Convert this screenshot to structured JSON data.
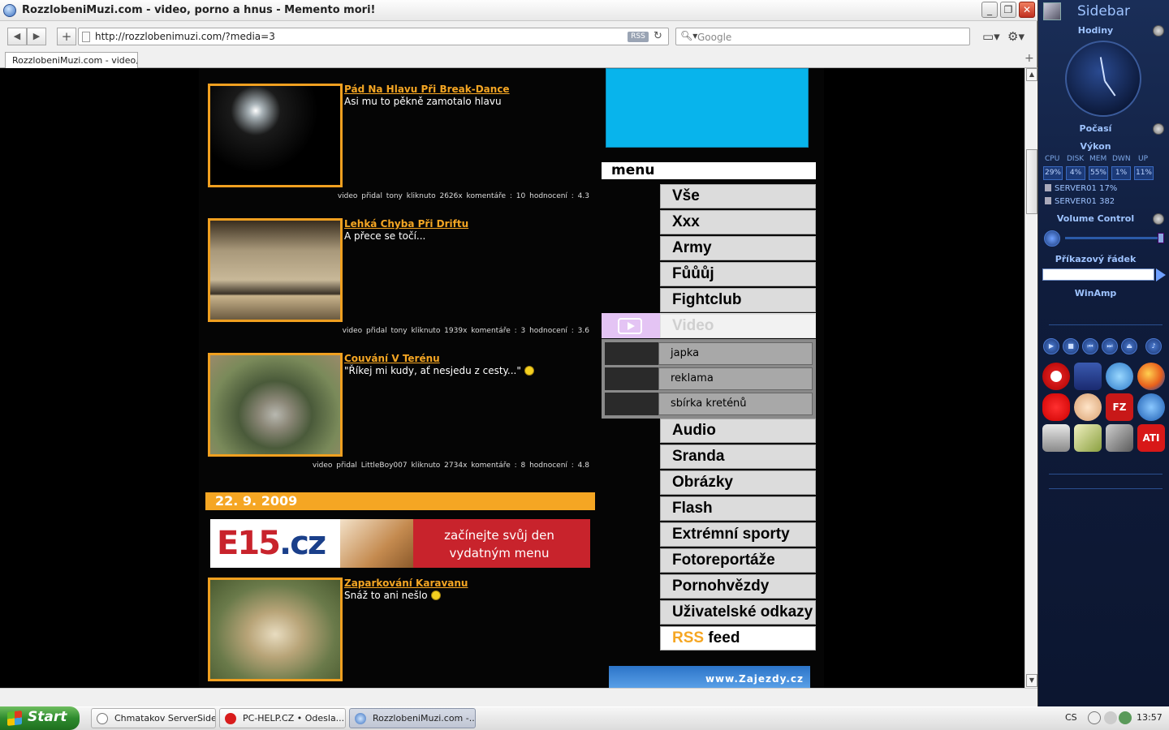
{
  "window": {
    "title": "RozzlobeniMuzi.com - video, porno a hnus - Memento mori!"
  },
  "address": {
    "url": "http://rozzlobenimuzi.com/?media=3",
    "rss": "RSS",
    "search_placeholder": "Google"
  },
  "tab": {
    "label": "RozzlobeniMuzi.com - video,..."
  },
  "items": [
    {
      "title": "Pád Na Hlavu Při Break-Dance",
      "desc": "Asi mu to pěkně zamotalo hlavu",
      "meta": "video  přidal tony  kliknuto 2626x  komentáře : 10   hodnocení : 4.3"
    },
    {
      "title": "Lehká Chyba Při Driftu",
      "desc": "A přece se točí...",
      "meta": "video  přidal tony  kliknuto 1939x  komentáře : 3   hodnocení : 3.6"
    },
    {
      "title": "Couvání V Terénu",
      "desc": "\"Říkej mi kudy, ať nesjedu z cesty...\"",
      "meta": "video  přidal LittleBoy007  kliknuto 2734x  komentáře : 8   hodnocení : 4.8"
    },
    {
      "title": "Zaparkování Karavanu",
      "desc": "Snáž to ani nešlo",
      "meta": ""
    }
  ],
  "date_band": "22. 9. 2009",
  "banner": {
    "logo_a": "E15",
    "logo_b": ".cz",
    "slogan": "začínejte svůj den vydatným menu"
  },
  "menu": {
    "heading": "menu",
    "top": [
      "Vše",
      "Xxx",
      "Army",
      "Fůůůj",
      "Fightclub"
    ],
    "active": "Video",
    "sub": [
      "japka",
      "reklama",
      "sbírka kreténů"
    ],
    "bottom": [
      "Audio",
      "Sranda",
      "Obrázky",
      "Flash",
      "Extrémní sporty",
      "Fotoreportáže",
      "Pornohvězdy",
      "Uživatelské odkazy"
    ],
    "rss_a": "RSS",
    "rss_b": " feed"
  },
  "zajezdy": "www.Zajezdy.cz",
  "sidebar": {
    "title": "Sidebar",
    "clock": "Hodiny",
    "weather": "Počasí",
    "perf": "Výkon",
    "perf_labels": [
      "CPU",
      "DISK",
      "MEM",
      "DWN",
      "UP"
    ],
    "perf_values": [
      "29%",
      "4%",
      "55%",
      "1%",
      "11%"
    ],
    "servers": [
      "SERVER01 17%",
      "SERVER01 382"
    ],
    "volume": "Volume Control",
    "cmd": "Příkazový řádek",
    "winamp": "WinAmp"
  },
  "taskbar": {
    "start": "Start",
    "buttons": [
      "Chmatakov ServerSide",
      "PC-HELP.CZ • Odesla...",
      "RozzlobeniMuzi.com -..."
    ],
    "lang": "CS",
    "time": "13:57"
  }
}
